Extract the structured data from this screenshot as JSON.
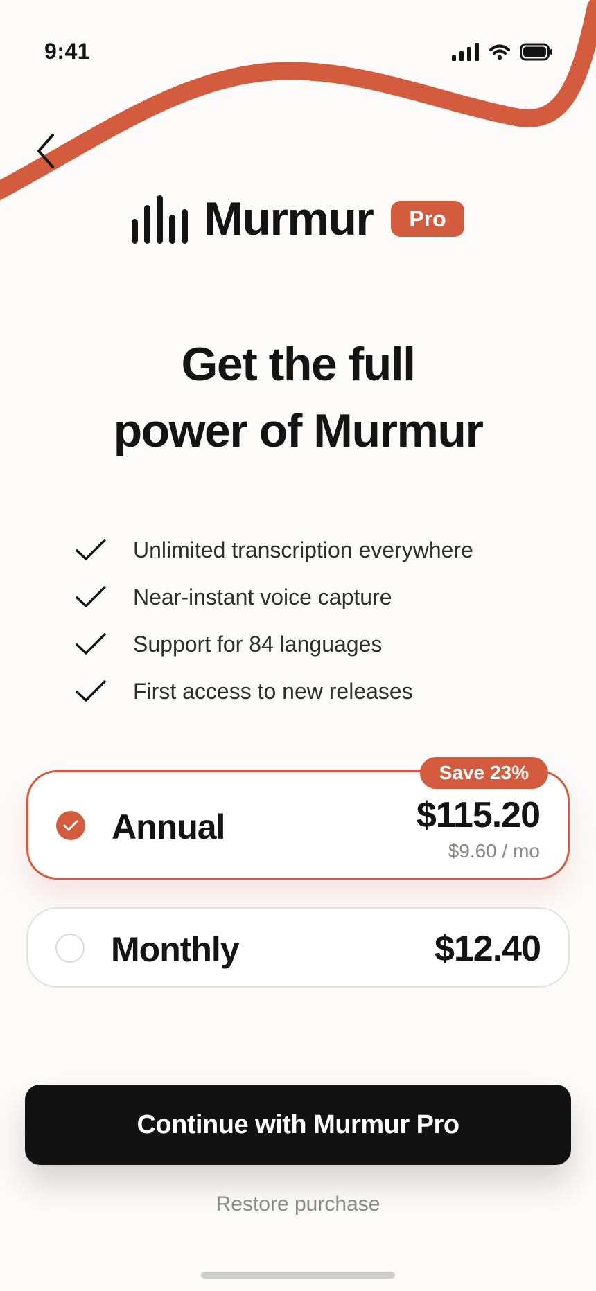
{
  "status_bar": {
    "time": "9:41",
    "icons": [
      "signal-icon",
      "wifi-icon",
      "battery-icon"
    ]
  },
  "nav": {
    "back_icon": "chevron-left-icon"
  },
  "brand": {
    "name": "Murmur",
    "badge": "Pro",
    "accent": "#d45c3e"
  },
  "headline": {
    "line1": "Get the full",
    "line2": "power of Murmur"
  },
  "features": [
    "Unlimited transcription everywhere",
    "Near-instant voice capture",
    "Support for 84 languages",
    "First access to new releases"
  ],
  "plans": {
    "annual": {
      "name": "Annual",
      "price": "$115.20",
      "per_month": "$9.60 / mo",
      "badge": "Save 23%",
      "selected": true
    },
    "monthly": {
      "name": "Monthly",
      "price": "$12.40",
      "selected": false
    }
  },
  "cta": {
    "label": "Continue with Murmur Pro"
  },
  "restore": {
    "label": "Restore purchase"
  }
}
